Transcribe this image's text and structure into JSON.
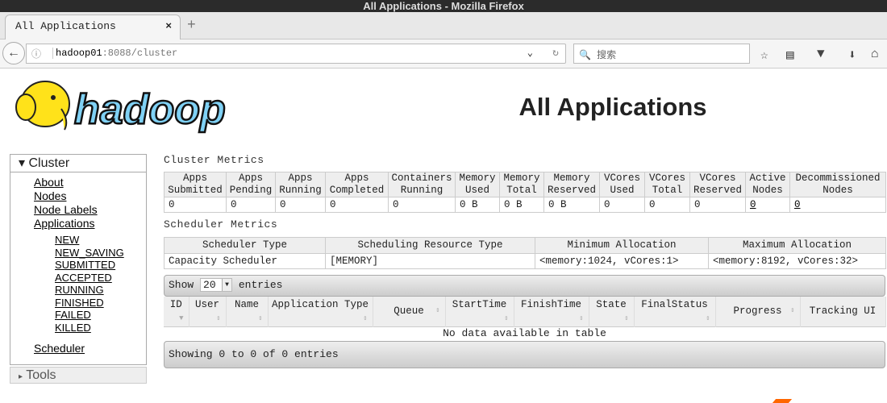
{
  "window": {
    "title": "All Applications - Mozilla Firefox"
  },
  "browser": {
    "tab_label": "All Applications",
    "url_host": "hadoop01",
    "url_path": ":8088/cluster",
    "search_placeholder": "搜索"
  },
  "page": {
    "logo_text": "hadoop",
    "title": "All Applications"
  },
  "sidebar": {
    "cluster_label": "Cluster",
    "items": [
      "About",
      "Nodes",
      "Node Labels",
      "Applications"
    ],
    "app_states": [
      "NEW",
      "NEW_SAVING",
      "SUBMITTED",
      "ACCEPTED",
      "RUNNING",
      "FINISHED",
      "FAILED",
      "KILLED"
    ],
    "scheduler": "Scheduler",
    "tools_label": "Tools"
  },
  "cluster_metrics": {
    "heading": "Cluster Metrics",
    "headers": [
      [
        "Apps",
        "Submitted"
      ],
      [
        "Apps",
        "Pending"
      ],
      [
        "Apps",
        "Running"
      ],
      [
        "Apps",
        "Completed"
      ],
      [
        "Containers",
        "Running"
      ],
      [
        "Memory",
        "Used"
      ],
      [
        "Memory",
        "Total"
      ],
      [
        "Memory",
        "Reserved"
      ],
      [
        "VCores",
        "Used"
      ],
      [
        "VCores",
        "Total"
      ],
      [
        "VCores",
        "Reserved"
      ],
      [
        "Active",
        "Nodes"
      ],
      [
        "Decommissioned",
        "Nodes"
      ]
    ],
    "values": [
      "0",
      "0",
      "0",
      "0",
      "0",
      "0 B",
      "0 B",
      "0 B",
      "0",
      "0",
      "0",
      "0",
      "0"
    ]
  },
  "scheduler_metrics": {
    "heading": "Scheduler Metrics",
    "headers": [
      "Scheduler Type",
      "Scheduling Resource Type",
      "Minimum Allocation",
      "Maximum Allocation"
    ],
    "values": [
      "Capacity Scheduler",
      "[MEMORY]",
      "<memory:1024, vCores:1>",
      "<memory:8192, vCores:32>"
    ]
  },
  "apps_table": {
    "show_label": "Show",
    "page_size": "20",
    "entries_label": "entries",
    "columns": [
      "ID",
      "User",
      "Name",
      "Application Type",
      "Queue",
      "StartTime",
      "FinishTime",
      "State",
      "FinalStatus",
      "Progress",
      "Tracking UI"
    ],
    "empty_message": "No data available in table",
    "info": "Showing 0 to 0 of 0 entries"
  }
}
